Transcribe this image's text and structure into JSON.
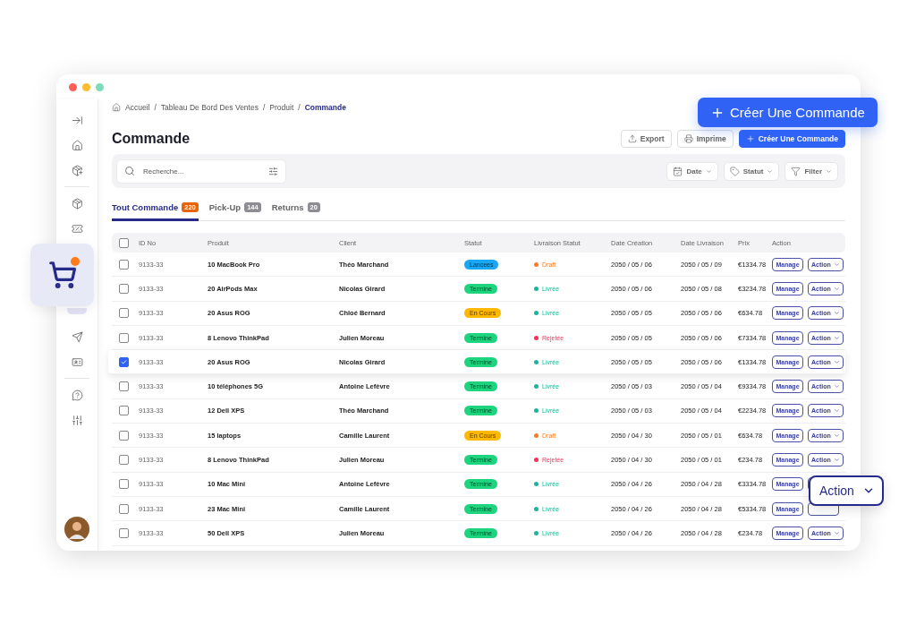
{
  "sidebar": {
    "items": [
      {
        "kind": "collapse",
        "selected": false
      },
      {
        "kind": "home",
        "selected": false
      },
      {
        "kind": "box-add",
        "selected": false
      },
      {
        "kind": "divider"
      },
      {
        "kind": "box-in",
        "selected": false
      },
      {
        "kind": "ticket",
        "selected": false
      },
      {
        "kind": "cart",
        "selected": true
      },
      {
        "kind": "send",
        "selected": false
      },
      {
        "kind": "card",
        "selected": false
      },
      {
        "kind": "divider"
      },
      {
        "kind": "help",
        "selected": false
      },
      {
        "kind": "sliders",
        "selected": false
      }
    ]
  },
  "breadcrumb": [
    {
      "label": "Accueil",
      "current": false
    },
    {
      "separator": "/",
      "label": "Tableau De Bord Des Ventes",
      "current": false
    },
    {
      "separator": "/",
      "label": "Produit",
      "current": false
    },
    {
      "separator": "/",
      "label": "Commande",
      "current": true
    }
  ],
  "page_title": "Commande",
  "header_buttons": [
    {
      "label": "Export",
      "kind": "export"
    },
    {
      "label": "Imprime",
      "kind": "print"
    },
    {
      "label": "Créer Une Commande",
      "kind": "create"
    }
  ],
  "toolbar": {
    "search": {
      "placeholder": "Recherche..."
    },
    "filters": [
      {
        "label": "Date",
        "kind": "date"
      },
      {
        "label": "Statut",
        "kind": "tag"
      },
      {
        "label": "Filter",
        "kind": "filter"
      }
    ]
  },
  "tabs": [
    {
      "label": "Tout Commande",
      "count": "220",
      "selected": true
    },
    {
      "label": "Pick-Up",
      "count": "144",
      "selected": false
    },
    {
      "label": "Returns",
      "count": "20",
      "selected": false
    }
  ],
  "table": {
    "select_all": {
      "checked": false
    },
    "columns": [
      "ID No",
      "Produit",
      "Client",
      "Statut",
      "Livraison Statut",
      "Date Création",
      "Date Livraison",
      "Prix",
      "Action"
    ],
    "rows": [
      {
        "checked": false,
        "id": "9133-33",
        "product": "10 MacBook Pro",
        "client": "Théo Marchand",
        "status": {
          "label": "Lancees",
          "color": "#1aa7f5"
        },
        "delivery": {
          "label": "Draft",
          "color": "#ff7a1a"
        },
        "created": "2050 / 05 / 06",
        "delivered": "2050 / 05 / 09",
        "price": "€1334.78",
        "manage": "Manage",
        "action": "Action"
      },
      {
        "checked": false,
        "id": "9133-33",
        "product": "20 AirPods Max",
        "client": "Nicolas Girard",
        "status": {
          "label": "Termine",
          "color": "#1ed47f"
        },
        "delivery": {
          "label": "Livrée",
          "color": "#14b89a"
        },
        "created": "2050 / 05 / 06",
        "delivered": "2050 / 05 / 08",
        "price": "€3234.78",
        "manage": "Manage",
        "action": "Action"
      },
      {
        "checked": false,
        "id": "9133-33",
        "product": "20 Asus ROG",
        "client": "Chloé Bernard",
        "status": {
          "label": "En Cours",
          "color": "#ffb800"
        },
        "delivery": {
          "label": "Livrée",
          "color": "#14b89a"
        },
        "created": "2050 / 05 / 05",
        "delivered": "2050 / 05 / 06",
        "price": "€634.78",
        "manage": "Manage",
        "action": "Action"
      },
      {
        "checked": false,
        "id": "9133-33",
        "product": "8 Lenovo ThinkPad",
        "client": "Julien Moreau",
        "status": {
          "label": "Termine",
          "color": "#1ed47f"
        },
        "delivery": {
          "label": "Rejetée",
          "color": "#ff2d55"
        },
        "created": "2050 / 05 / 05",
        "delivered": "2050 / 05 / 06",
        "price": "€7334.78",
        "manage": "Manage",
        "action": "Action"
      },
      {
        "checked": true,
        "id": "9133-33",
        "product": "20 Asus ROG",
        "client": "Nicolas Girard",
        "status": {
          "label": "Termine",
          "color": "#1ed47f"
        },
        "delivery": {
          "label": "Livrée",
          "color": "#14b89a"
        },
        "created": "2050 / 05 / 05",
        "delivered": "2050 / 05 / 06",
        "price": "€1334.78",
        "manage": "Manage",
        "action": "Action"
      },
      {
        "checked": false,
        "id": "9133-33",
        "product": "10 téléphones 5G",
        "client": "Antoine Lefèvre",
        "status": {
          "label": "Termine",
          "color": "#1ed47f"
        },
        "delivery": {
          "label": "Livrée",
          "color": "#14b89a"
        },
        "created": "2050 / 05 / 03",
        "delivered": "2050 / 05 / 04",
        "price": "€9334.78",
        "manage": "Manage",
        "action": "Action"
      },
      {
        "checked": false,
        "id": "9133-33",
        "product": "12 Dell XPS",
        "client": "Théo Marchand",
        "status": {
          "label": "Termine",
          "color": "#1ed47f"
        },
        "delivery": {
          "label": "Livrée",
          "color": "#14b89a"
        },
        "created": "2050 / 05 / 03",
        "delivered": "2050 / 05 / 04",
        "price": "€2234.78",
        "manage": "Manage",
        "action": "Action"
      },
      {
        "checked": false,
        "id": "9133-33",
        "product": "15 laptops",
        "client": "Camille Laurent",
        "status": {
          "label": "En Cours",
          "color": "#ffb800"
        },
        "delivery": {
          "label": "Draft",
          "color": "#ff7a1a"
        },
        "created": "2050 / 04 / 30",
        "delivered": "2050 / 05 / 01",
        "price": "€634.78",
        "manage": "Manage",
        "action": "Action"
      },
      {
        "checked": false,
        "id": "9133-33",
        "product": "8 Lenovo ThinkPad",
        "client": "Julien Moreau",
        "status": {
          "label": "Termine",
          "color": "#1ed47f"
        },
        "delivery": {
          "label": "Rejetée",
          "color": "#ff2d55"
        },
        "created": "2050 / 04 / 30",
        "delivered": "2050 / 05 / 01",
        "price": "€234.78",
        "manage": "Manage",
        "action": "Action"
      },
      {
        "checked": false,
        "id": "9133-33",
        "product": "10 Mac Mini",
        "client": "Antoine Lefèvre",
        "status": {
          "label": "Termine",
          "color": "#1ed47f"
        },
        "delivery": {
          "label": "Livrée",
          "color": "#14b89a"
        },
        "created": "2050 / 04 / 26",
        "delivered": "2050 / 04 / 28",
        "price": "€3334.78",
        "manage": "Manage"
      },
      {
        "checked": false,
        "id": "9133-33",
        "product": "23 Mac Mini",
        "client": "Camille Laurent",
        "status": {
          "label": "Termine",
          "color": "#1ed47f"
        },
        "delivery": {
          "label": "Livrée",
          "color": "#14b89a"
        },
        "created": "2050 / 04 / 26",
        "delivered": "2050 / 04 / 28",
        "price": "€5334.78",
        "manage": "Manage"
      },
      {
        "checked": false,
        "id": "9133-33",
        "product": "50 Dell XPS",
        "client": "Julien Moreau",
        "status": {
          "label": "Termine",
          "color": "#1ed47f"
        },
        "delivery": {
          "label": "Livrée",
          "color": "#14b89a"
        },
        "created": "2050 / 04 / 26",
        "delivered": "2050 / 04 / 28",
        "price": "€234.78",
        "manage": "Manage",
        "action": "Action"
      }
    ]
  },
  "callouts": {
    "create_button": {
      "label": "Créer Une Commande"
    },
    "cart_tile": {
      "badge": true
    },
    "action_menu": {
      "label": "Action"
    }
  }
}
